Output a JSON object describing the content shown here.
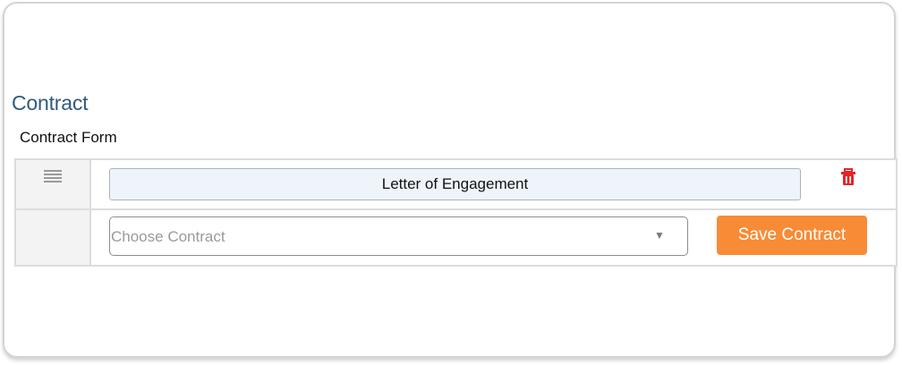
{
  "section": {
    "title": "Contract",
    "form_label": "Contract Form"
  },
  "contract_row": {
    "drag_icon": "list-drag-handle-icon",
    "title_value": "Letter of Engagement",
    "delete_icon": "trash-icon"
  },
  "contract_select": {
    "placeholder": "Choose Contract",
    "caret_icon": "caret-down-icon"
  },
  "actions": {
    "save_label": "Save Contract"
  },
  "colors": {
    "title": "#2f5a7e",
    "save_button": "#f88b35",
    "delete_icon": "#e5242a",
    "input_bg": "#eff4fb"
  }
}
